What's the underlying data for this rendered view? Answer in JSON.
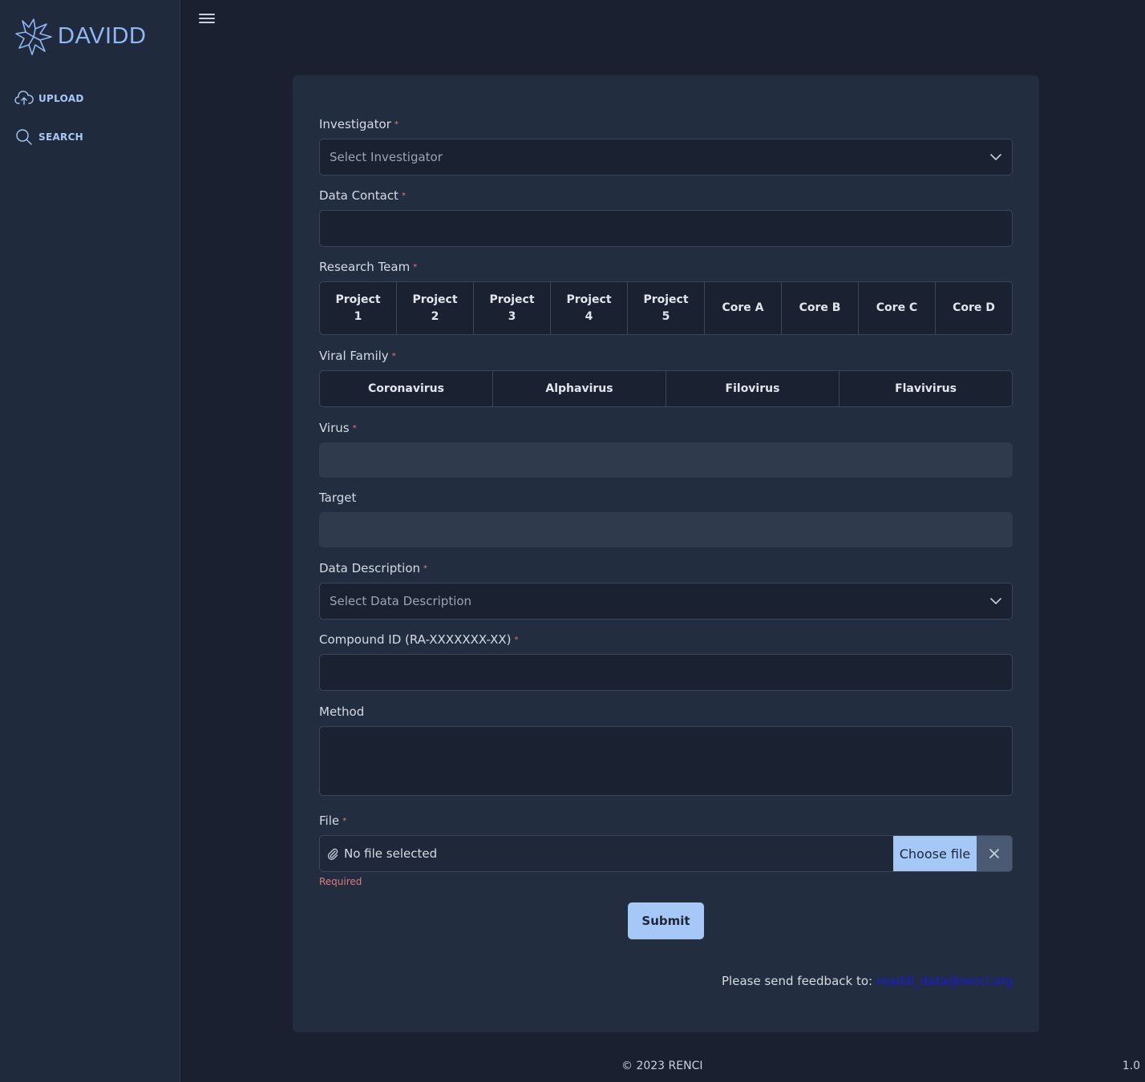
{
  "app": {
    "name": "DAVIDD"
  },
  "sidebar": {
    "items": [
      {
        "label": "UPLOAD",
        "icon": "cloud-upload-icon"
      },
      {
        "label": "SEARCH",
        "icon": "search-icon"
      }
    ]
  },
  "form": {
    "investigator": {
      "label": "Investigator",
      "required": "*",
      "placeholder": "Select Investigator"
    },
    "data_contact": {
      "label": "Data Contact",
      "required": "*",
      "value": ""
    },
    "research_team": {
      "label": "Research Team",
      "required": "*",
      "options": [
        "Project\n1",
        "Project\n2",
        "Project\n3",
        "Project\n4",
        "Project\n5",
        "Core A",
        "Core B",
        "Core C",
        "Core D"
      ]
    },
    "viral_family": {
      "label": "Viral Family",
      "required": "*",
      "options": [
        "Coronavirus",
        "Alphavirus",
        "Filovirus",
        "Flavivirus"
      ]
    },
    "virus": {
      "label": "Virus",
      "required": "*",
      "value": ""
    },
    "target": {
      "label": "Target",
      "value": ""
    },
    "data_description": {
      "label": "Data Description",
      "required": "*",
      "placeholder": "Select Data Description"
    },
    "compound_id": {
      "label": "Compound ID (RA-XXXXXXX-XX)",
      "required": "*",
      "value": ""
    },
    "method": {
      "label": "Method",
      "value": ""
    },
    "file": {
      "label": "File",
      "required": "*",
      "status": "No file selected",
      "choose_label": "Choose file",
      "error": "Required"
    },
    "submit_label": "Submit",
    "feedback": {
      "text": "Please send feedback to:",
      "email": "readdi_data@renci.org"
    }
  },
  "footer": {
    "copyright": "© 2023 RENCI",
    "version": "1.0"
  },
  "colors": {
    "accent": "#a6c8f6",
    "required": "#e07a7a",
    "background": "#1a2030",
    "card": "#222d40",
    "link": "#1a1adb"
  }
}
